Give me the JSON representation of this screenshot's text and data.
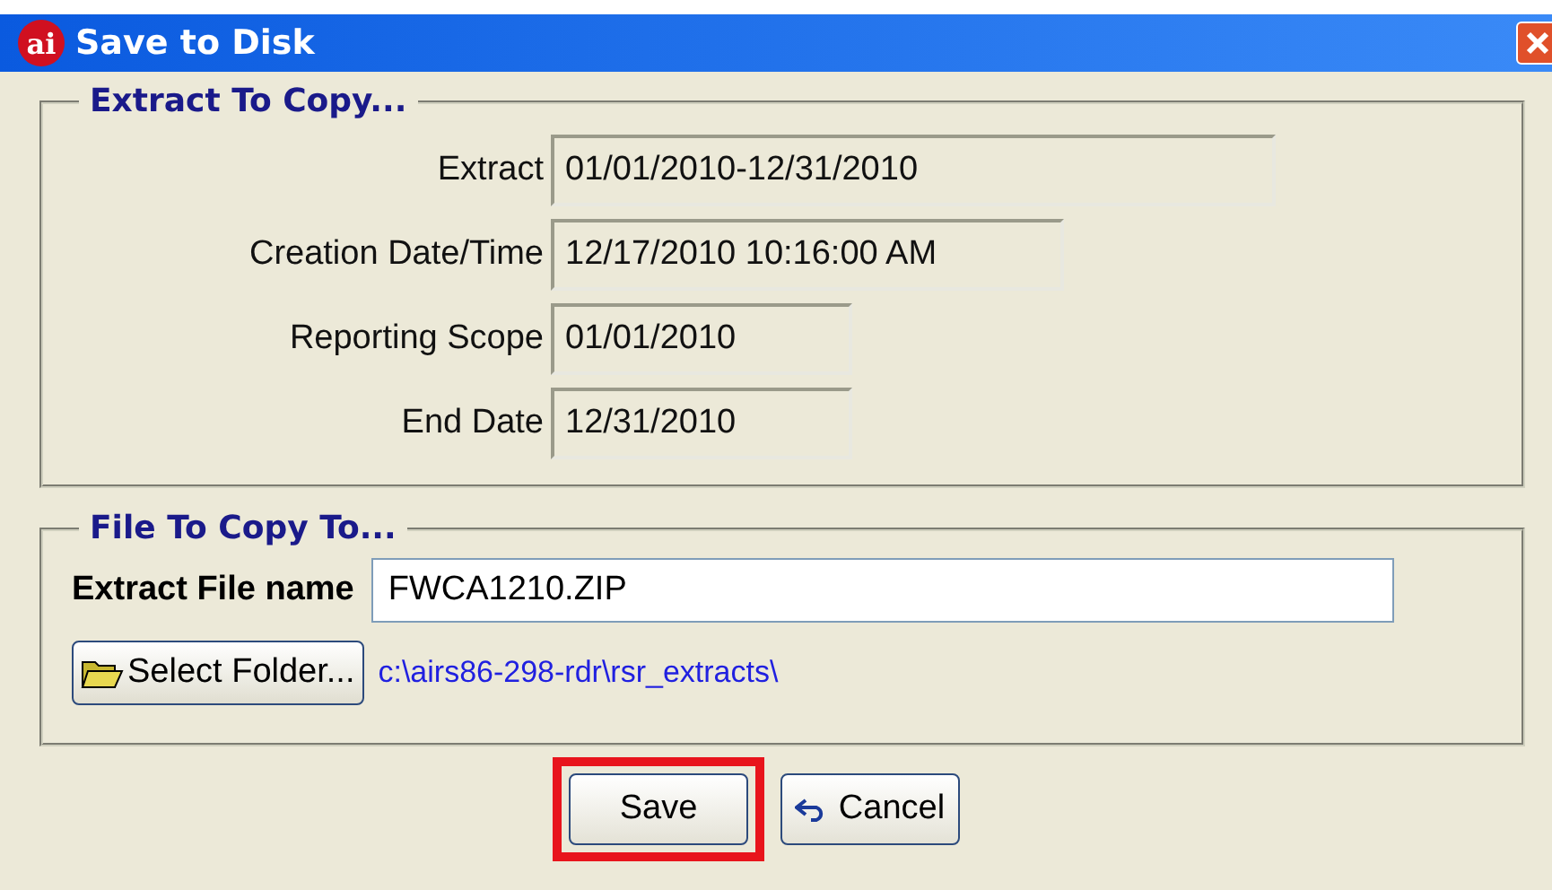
{
  "window": {
    "logo": "ai",
    "title": "Save to Disk"
  },
  "extract_group": {
    "legend": "Extract To Copy...",
    "fields": [
      {
        "label": "Extract",
        "value": "01/01/2010-12/31/2010"
      },
      {
        "label": "Creation Date/Time",
        "value": "12/17/2010 10:16:00 AM"
      },
      {
        "label": "Reporting Scope",
        "value": "01/01/2010"
      },
      {
        "label": "End Date",
        "value": "12/31/2010"
      }
    ]
  },
  "file_group": {
    "legend": "File To Copy To...",
    "file_name_label": "Extract File name",
    "file_name": "FWCA1210.ZIP",
    "select_folder_button": "Select Folder...",
    "folder_path": "c:\\airs86-298-rdr\\rsr_extracts\\"
  },
  "buttons": [
    {
      "label": "Save",
      "kind": "save",
      "highlighted": true
    },
    {
      "label": "Cancel",
      "kind": "cancel",
      "highlighted": false
    }
  ]
}
